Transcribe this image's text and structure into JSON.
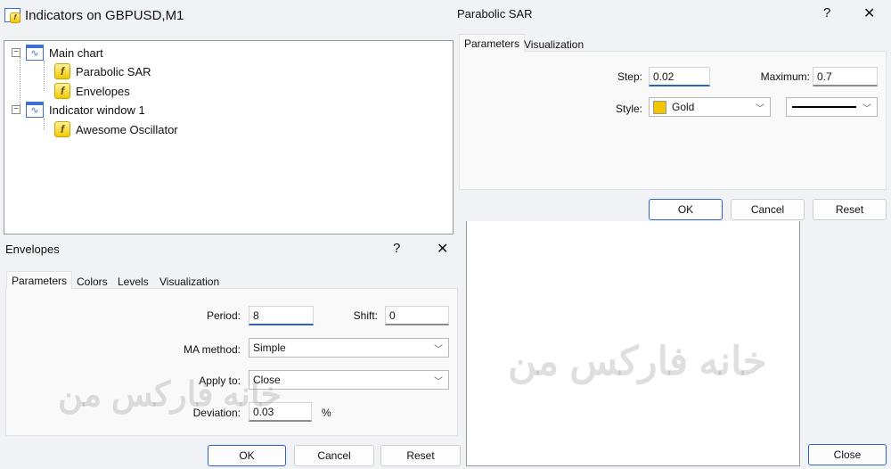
{
  "main_window": {
    "title": "Indicators on GBPUSD,M1",
    "close_label": "Close",
    "tree": [
      {
        "label": "Main chart",
        "type": "window",
        "children": [
          "Parabolic SAR",
          "Envelopes"
        ]
      },
      {
        "label": "Indicator window 1",
        "type": "window",
        "children": [
          "Awesome Oscillator"
        ]
      }
    ]
  },
  "parabolic_dialog": {
    "title": "Parabolic SAR",
    "help": "?",
    "close": "✕",
    "tabs": [
      "Parameters",
      "Visualization"
    ],
    "step_label": "Step:",
    "step_value": "0.02",
    "maximum_label": "Maximum:",
    "maximum_value": "0.7",
    "style_label": "Style:",
    "color_value": "Gold",
    "color_hex": "#f2c500",
    "ok": "OK",
    "cancel": "Cancel",
    "reset": "Reset"
  },
  "envelopes_dialog": {
    "title": "Envelopes",
    "help": "?",
    "close": "✕",
    "tabs": [
      "Parameters",
      "Colors",
      "Levels",
      "Visualization"
    ],
    "period_label": "Period:",
    "period_value": "8",
    "shift_label": "Shift:",
    "shift_value": "0",
    "ma_method_label": "MA method:",
    "ma_method_value": "Simple",
    "apply_to_label": "Apply to:",
    "apply_to_value": "Close",
    "deviation_label": "Deviation:",
    "deviation_value": "0.03",
    "percent": "%",
    "ok": "OK",
    "cancel": "Cancel",
    "reset": "Reset"
  },
  "watermark": "خانه فارکس من"
}
